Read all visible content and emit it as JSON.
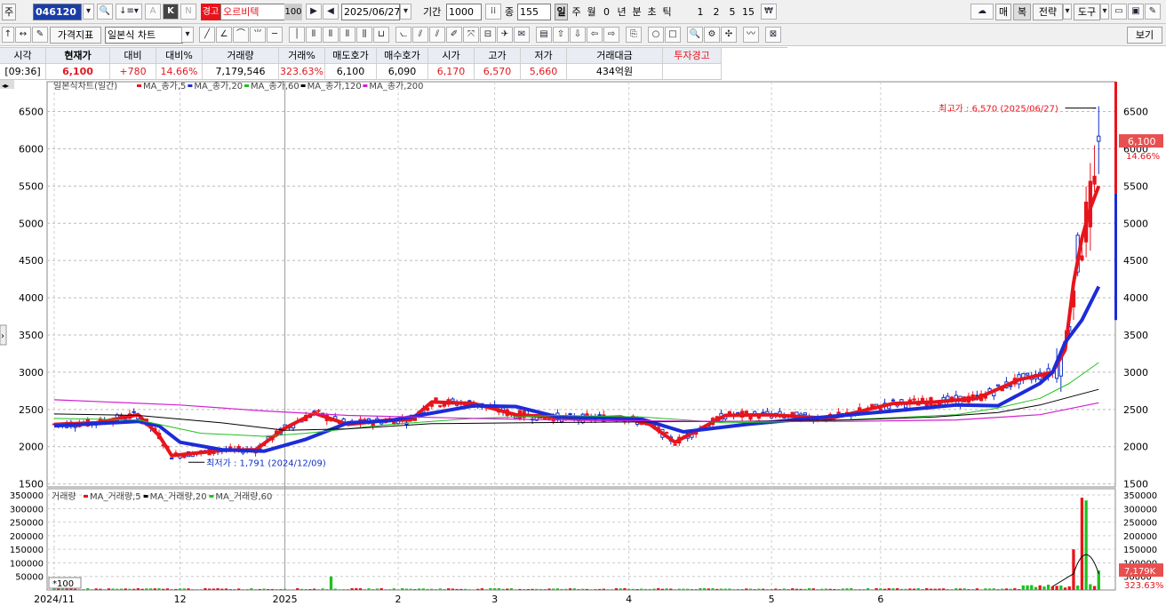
{
  "toolbar": {
    "market_btn": "주",
    "stock_code": "046120",
    "k_btn": "K",
    "n_btn": "N",
    "a_btn": "A",
    "warning_badge": "경고",
    "stock_name": "오르비텍",
    "margin_ratio": "100",
    "date": "2025/06/27",
    "period_label": "기간",
    "period_value": "1000",
    "count_label": "종",
    "count_value": "155",
    "period_types": [
      "일",
      "주",
      "월",
      "0",
      "년",
      "분",
      "초",
      "틱"
    ],
    "active_period": "일",
    "minute_options": [
      "1",
      "2",
      "5",
      "15"
    ],
    "right_buttons": {
      "sell": "매",
      "buy": "복",
      "strategy": "전략",
      "tools": "도구"
    },
    "indicator_btn": "가격지표",
    "chart_type": "일본식 차트",
    "view_btn": "보기"
  },
  "quote": {
    "headers": [
      "시각",
      "현재가",
      "대비",
      "대비%",
      "거래량",
      "거래%",
      "매도호가",
      "매수호가",
      "시가",
      "고가",
      "저가",
      "거래대금",
      "투자경고"
    ],
    "values": [
      "[09:36]",
      "6,100",
      "+780",
      "14.66%",
      "7,179,546",
      "323.63%",
      "6,100",
      "6,090",
      "6,170",
      "6,570",
      "5,660",
      "434억원",
      ""
    ]
  },
  "price_panel": {
    "legend_title": "일본식차트(일간)",
    "ma_legends": [
      {
        "label": "MA_종가,5",
        "color": "#e8141c"
      },
      {
        "label": "MA_종가,20",
        "color": "#1c2cd8"
      },
      {
        "label": "MA_종가,60",
        "color": "#20c020"
      },
      {
        "label": "MA_종가,120",
        "color": "#000000"
      },
      {
        "label": "MA_종가,200",
        "color": "#d020d0"
      }
    ],
    "y_ticks": [
      6500,
      6000,
      5500,
      5000,
      4500,
      4000,
      3500,
      3000,
      2500,
      2000,
      1500
    ],
    "y_range": [
      1460,
      6900
    ],
    "high_annotation": "최고가 : 6,570 (2025/06/27)",
    "low_annotation": "최저가 : 1,791 (2024/12/09)",
    "current_price_tag": "6,100",
    "current_pct_tag": "14.66%"
  },
  "volume_panel": {
    "legend_title": "거래량",
    "ma_legends": [
      {
        "label": "MA_거래량,5",
        "color": "#e8141c"
      },
      {
        "label": "MA_거래량,20",
        "color": "#000000"
      },
      {
        "label": "MA_거래량,60",
        "color": "#20c020"
      }
    ],
    "y_ticks": [
      350000,
      300000,
      250000,
      200000,
      150000,
      100000,
      50000
    ],
    "unit_label": "*100",
    "volume_tag": "7,179K",
    "volume_pct_tag": "323.63%"
  },
  "x_axis_labels": [
    "2024/11",
    "12",
    "2025",
    "2",
    "3",
    "4",
    "5",
    "6"
  ],
  "chart_data": {
    "type": "candlestick",
    "title": "일본식차트(일간)",
    "y_range": [
      1460,
      6900
    ],
    "ma_series": [
      {
        "name": "MA_종가,5",
        "color": "#e8141c",
        "points": [
          [
            0,
            2300
          ],
          [
            10,
            2320
          ],
          [
            20,
            2430
          ],
          [
            25,
            2150
          ],
          [
            28,
            1880
          ],
          [
            40,
            1950
          ],
          [
            48,
            1960
          ],
          [
            55,
            2250
          ],
          [
            62,
            2450
          ],
          [
            70,
            2300
          ],
          [
            80,
            2360
          ],
          [
            85,
            2360
          ],
          [
            90,
            2600
          ],
          [
            100,
            2580
          ],
          [
            110,
            2430
          ],
          [
            125,
            2380
          ],
          [
            135,
            2400
          ],
          [
            142,
            2300
          ],
          [
            148,
            2060
          ],
          [
            160,
            2420
          ],
          [
            170,
            2430
          ],
          [
            185,
            2380
          ],
          [
            200,
            2580
          ],
          [
            210,
            2600
          ],
          [
            220,
            2650
          ],
          [
            230,
            2900
          ],
          [
            238,
            3000
          ],
          [
            241,
            3300
          ],
          [
            243,
            4200
          ],
          [
            245,
            4800
          ],
          [
            247,
            5200
          ],
          [
            249,
            5500
          ]
        ]
      },
      {
        "name": "MA_종가,20",
        "color": "#1c2cd8",
        "points": [
          [
            0,
            2280
          ],
          [
            20,
            2340
          ],
          [
            25,
            2280
          ],
          [
            30,
            2060
          ],
          [
            40,
            1960
          ],
          [
            50,
            1940
          ],
          [
            60,
            2100
          ],
          [
            70,
            2320
          ],
          [
            80,
            2350
          ],
          [
            90,
            2450
          ],
          [
            100,
            2550
          ],
          [
            110,
            2540
          ],
          [
            120,
            2400
          ],
          [
            140,
            2370
          ],
          [
            150,
            2200
          ],
          [
            165,
            2300
          ],
          [
            180,
            2380
          ],
          [
            200,
            2480
          ],
          [
            215,
            2560
          ],
          [
            225,
            2550
          ],
          [
            235,
            2850
          ],
          [
            238,
            3000
          ],
          [
            241,
            3400
          ],
          [
            245,
            3700
          ],
          [
            249,
            4150
          ]
        ]
      },
      {
        "name": "MA_종가,60",
        "color": "#20c020",
        "points": [
          [
            0,
            2380
          ],
          [
            20,
            2360
          ],
          [
            35,
            2180
          ],
          [
            50,
            2140
          ],
          [
            60,
            2180
          ],
          [
            80,
            2300
          ],
          [
            100,
            2380
          ],
          [
            120,
            2420
          ],
          [
            140,
            2400
          ],
          [
            160,
            2320
          ],
          [
            180,
            2340
          ],
          [
            200,
            2390
          ],
          [
            215,
            2430
          ],
          [
            225,
            2520
          ],
          [
            235,
            2650
          ],
          [
            242,
            2850
          ],
          [
            249,
            3130
          ]
        ]
      },
      {
        "name": "MA_종가,120",
        "color": "#000000",
        "points": [
          [
            0,
            2440
          ],
          [
            20,
            2420
          ],
          [
            40,
            2320
          ],
          [
            55,
            2220
          ],
          [
            70,
            2240
          ],
          [
            90,
            2310
          ],
          [
            110,
            2320
          ],
          [
            130,
            2330
          ],
          [
            160,
            2340
          ],
          [
            190,
            2360
          ],
          [
            210,
            2400
          ],
          [
            225,
            2460
          ],
          [
            235,
            2560
          ],
          [
            243,
            2680
          ],
          [
            249,
            2770
          ]
        ]
      },
      {
        "name": "MA_종가,200",
        "color": "#d020d0",
        "points": [
          [
            0,
            2630
          ],
          [
            30,
            2560
          ],
          [
            50,
            2480
          ],
          [
            70,
            2420
          ],
          [
            100,
            2380
          ],
          [
            130,
            2350
          ],
          [
            160,
            2340
          ],
          [
            190,
            2340
          ],
          [
            215,
            2360
          ],
          [
            235,
            2430
          ],
          [
            249,
            2590
          ]
        ]
      }
    ],
    "last_candle": {
      "open": 6170,
      "high": 6570,
      "low": 5660,
      "close": 6100
    },
    "period_high": {
      "value": 6570,
      "date": "2025/06/27"
    },
    "period_low": {
      "value": 1791,
      "date": "2024/12/09"
    },
    "volume": {
      "y_range": [
        0,
        360000
      ],
      "spikes": [
        [
          66,
          50000
        ],
        [
          243,
          150000
        ],
        [
          245,
          340000
        ],
        [
          246,
          330000
        ],
        [
          249,
          71795
        ]
      ]
    }
  }
}
